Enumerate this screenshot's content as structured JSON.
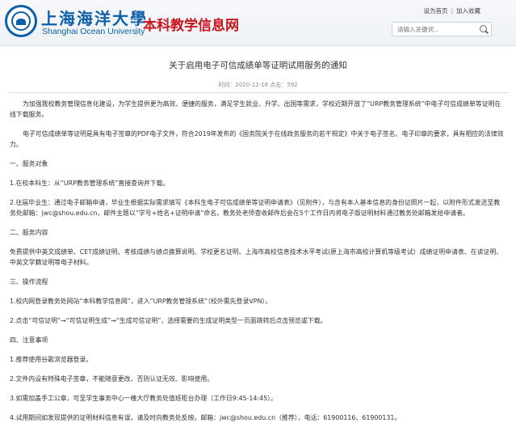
{
  "header": {
    "logo_cn": "上海海洋大學",
    "logo_en": "Shanghai Ocean University",
    "site_name": "本科教学信息网",
    "links": {
      "set_home": "设为首页",
      "bookmark": "加入收藏"
    },
    "search_placeholder": "请输入关键词..."
  },
  "article": {
    "title": "关于启用电子可信成绩单等证明试用服务的通知",
    "meta": "时间：2020-12-16  点击：592",
    "paragraphs": [
      "为加强我校教务管理信息化建设，为学生提供更为高效、便捷的服务，满足学生就业、升学、出国等需求，学校近期开放了“URP教务管理系统”中电子可信成绩单等证明在线下载服务。",
      "电子可信成绩单等证明是具有电子签章的PDF电子文件，符合2019年发布的《国务院关于在线政务服务的若干规定》中关于电子签名、电子印章的要求，具有相应的法律效力。",
      "一、服务对象",
      "1.在校本科生：从“URP教务管理系统”直接查询并下载。",
      "2.往届毕业生：通过电子邮箱申请，毕业生根据实际需求填写《本科生电子可信成绩单等证明申请表》（见附件），与含有本人基本信息的身份证照片一起，以附件形式发送至教务处邮箱：jwc@shou.edu.cn，邮件主题以“学号+姓名+证明申请”命名。教务处老师查收邮件后会在5个工作日内将电子版证明材料通过教务处邮箱发给申请者。",
      "二、服务内容",
      "免费提供中英文成绩单、CET成绩证明、考核成绩与绩点换算说明、学校更名证明、上海市高校信息技术水平考试(原上海市高校计算机等级考试）成绩证明申请表、在读证明、中英文学籍证明等电子材料。",
      "三、操作流程",
      "1.校内网登录教务处网站“本科教学信息网”，进入“URP教务管理系统”（校外需先登录VPN）。",
      "2.点击“可信证明”→“可信证明生成”→“生成可信证明”，选择需要的生成证明类型一页面跳转后点击预览或下载。",
      "四、注意事项",
      "1.推荐使用谷歌浏览器登录。",
      "2.文件内设有特殊电子签章，不能随意更改，否则认证无效、影响使用。",
      "3.如需加盖手工公章，可至学生事务中心一楼大厅教务处值班柜台办理（工作日9:45-14:45）。",
      "4.试用期间如发现提供的证明材料信息有误，请及时向教务处反映。邮箱：jwc@shou.edu.cn（推荐），电话：61900116、61900131。"
    ]
  }
}
